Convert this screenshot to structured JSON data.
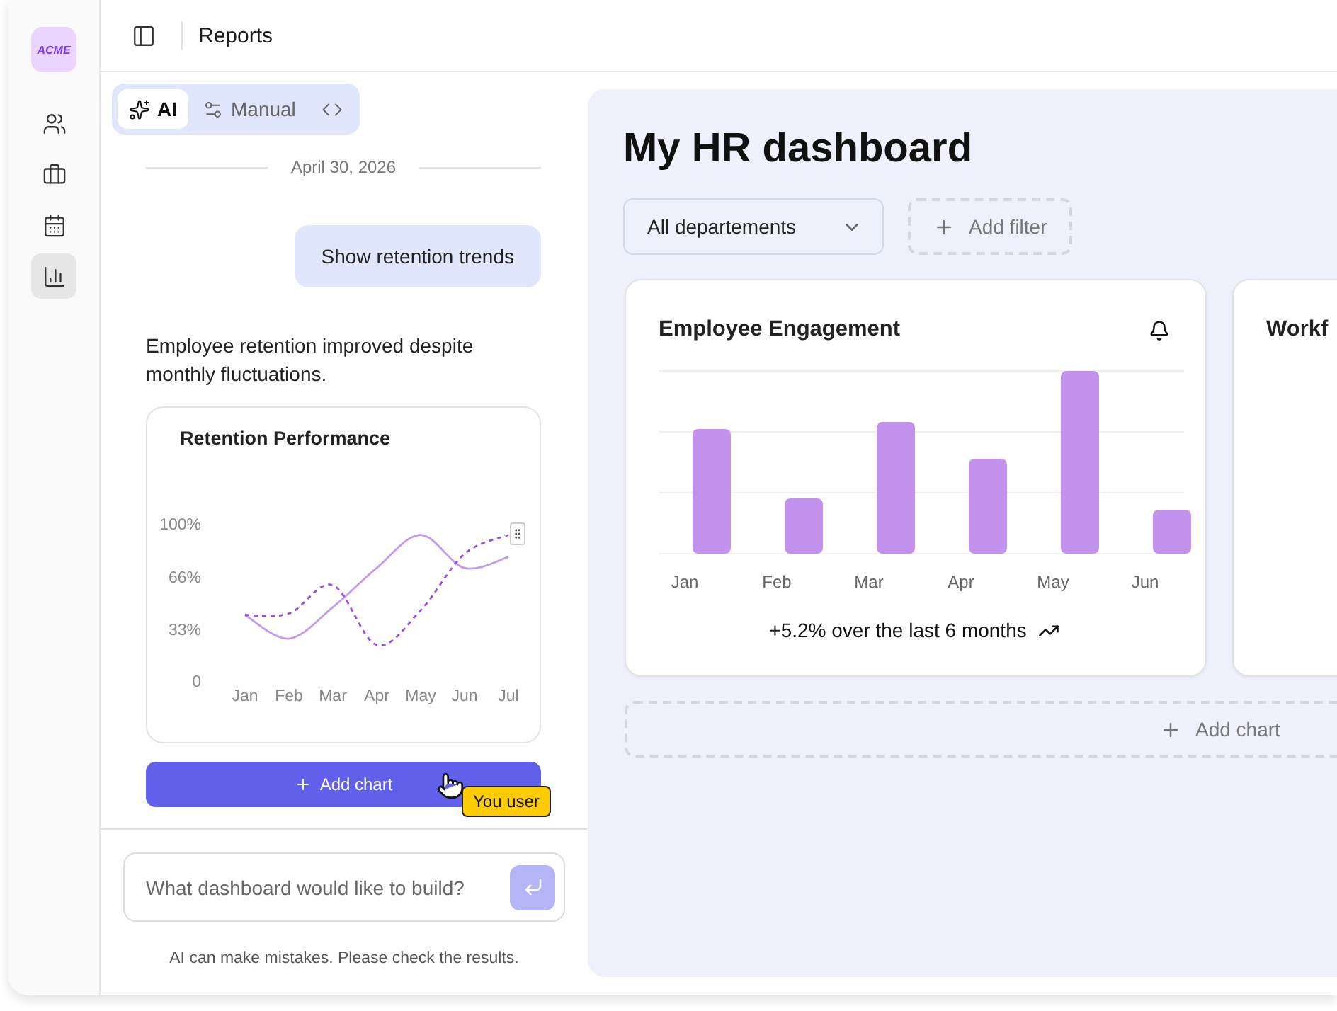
{
  "app": {
    "logo": "ACME"
  },
  "nav_items": [
    {
      "selected": false
    },
    {
      "selected": false
    },
    {
      "selected": false
    },
    {
      "selected": true
    }
  ],
  "header": {
    "title": "Reports"
  },
  "chat": {
    "modes": [
      {
        "kind": "labeled",
        "label": "AI",
        "selected": true
      },
      {
        "kind": "labeled",
        "label": "Manual",
        "selected": false
      },
      {
        "kind": "icon",
        "selected": false
      }
    ],
    "date": "April 30, 2026",
    "user_message": "Show retention trends",
    "reply": "Employee retention improved despite monthly fluctuations.",
    "chart_card": {
      "title": "Retention Performance",
      "chart_data": {
        "type": "line",
        "categories": [
          "Jan",
          "Feb",
          "Mar",
          "Apr",
          "May",
          "Jun",
          "Jul"
        ],
        "ylim": [
          0,
          100
        ],
        "yticks": [
          {
            "value": 0,
            "label": "0"
          },
          {
            "value": 33,
            "label": "33%"
          },
          {
            "value": 66,
            "label": "66%"
          },
          {
            "value": 100,
            "label": "100%"
          }
        ],
        "series": [
          {
            "color": "#c49af0",
            "line_style": "solid",
            "values": [
              42,
              27,
              47,
              72,
              93,
              72,
              79
            ]
          },
          {
            "color": "#9b4de0",
            "line_style": "dashed",
            "values": [
              42,
              43,
              61,
              23,
              45,
              81,
              93
            ]
          }
        ]
      }
    },
    "add_chart_button": "Add chart",
    "cursor_tooltip": "You user",
    "input": {
      "placeholder": "What dashboard would like to build?"
    },
    "disclaimer": "AI can make mistakes. Please check the results."
  },
  "dashboard": {
    "title": "My HR dashboard",
    "department_filter": "All departements",
    "add_filter": "Add filter",
    "cards": [
      {
        "kind": "bars",
        "title": "Employee Engagement",
        "months": [
          "Jan",
          "Feb",
          "Mar",
          "Apr",
          "May",
          "Jun"
        ],
        "summary": "+5.2% over the last 6 months"
      },
      {
        "kind": "cut",
        "title": "Workf"
      }
    ],
    "add_chart": "Add chart"
  }
}
